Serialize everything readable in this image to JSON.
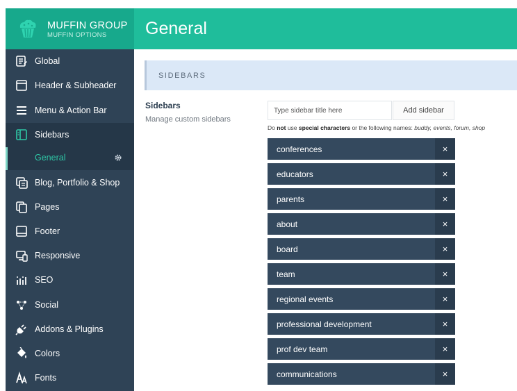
{
  "brand": {
    "name": "MUFFIN GROUP",
    "sub": "MUFFIN OPTIONS"
  },
  "sidebar": {
    "items": [
      {
        "label": "Global",
        "icon": "global-icon"
      },
      {
        "label": "Header & Subheader",
        "icon": "header-icon"
      },
      {
        "label": "Menu & Action Bar",
        "icon": "menu-icon"
      },
      {
        "label": "Sidebars",
        "icon": "sidebars-icon",
        "active": true
      },
      {
        "label": "Blog, Portfolio & Shop",
        "icon": "blog-icon"
      },
      {
        "label": "Pages",
        "icon": "pages-icon"
      },
      {
        "label": "Footer",
        "icon": "footer-icon"
      },
      {
        "label": "Responsive",
        "icon": "responsive-icon"
      },
      {
        "label": "SEO",
        "icon": "seo-icon"
      },
      {
        "label": "Social",
        "icon": "social-icon"
      },
      {
        "label": "Addons & Plugins",
        "icon": "plugin-icon"
      },
      {
        "label": "Colors",
        "icon": "colors-icon"
      },
      {
        "label": "Fonts",
        "icon": "fonts-icon"
      }
    ],
    "submenu": {
      "label": "General"
    }
  },
  "header": {
    "title": "General"
  },
  "section": {
    "label": "SIDEBARS"
  },
  "field": {
    "title": "Sidebars",
    "desc": "Manage custom sidebars",
    "input_placeholder": "Type sidebar title here",
    "add_label": "Add sidebar",
    "hint": {
      "p1": "Do ",
      "p2": "not",
      "p3": " use ",
      "p4": "special characters",
      "p5": " or the following names: ",
      "p6": "buddy, events, forum, shop"
    }
  },
  "sidebars": [
    "conferences",
    "educators",
    "parents",
    "about",
    "board",
    "team",
    "regional events",
    "professional development",
    "prof dev team",
    "communications"
  ],
  "remove_glyph": "×",
  "colors": {
    "brand": "#17a98c",
    "header": "#1fbd9b",
    "sidebar": "#2f4356",
    "item": "#34495e"
  }
}
